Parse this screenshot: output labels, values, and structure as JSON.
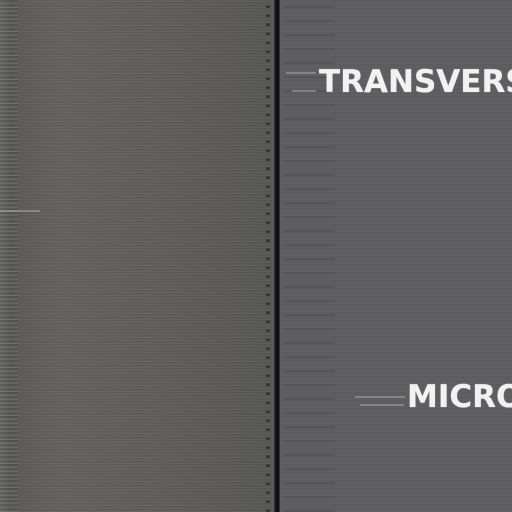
{
  "screen": {
    "labels": {
      "top": "TRANSVERS",
      "bottom": "MICRO"
    }
  },
  "colors": {
    "left_panel": "#5e5d5b",
    "right_panel": "#5d5d5f",
    "divider": "#0c0c0c",
    "text": "#f2f2f2"
  }
}
